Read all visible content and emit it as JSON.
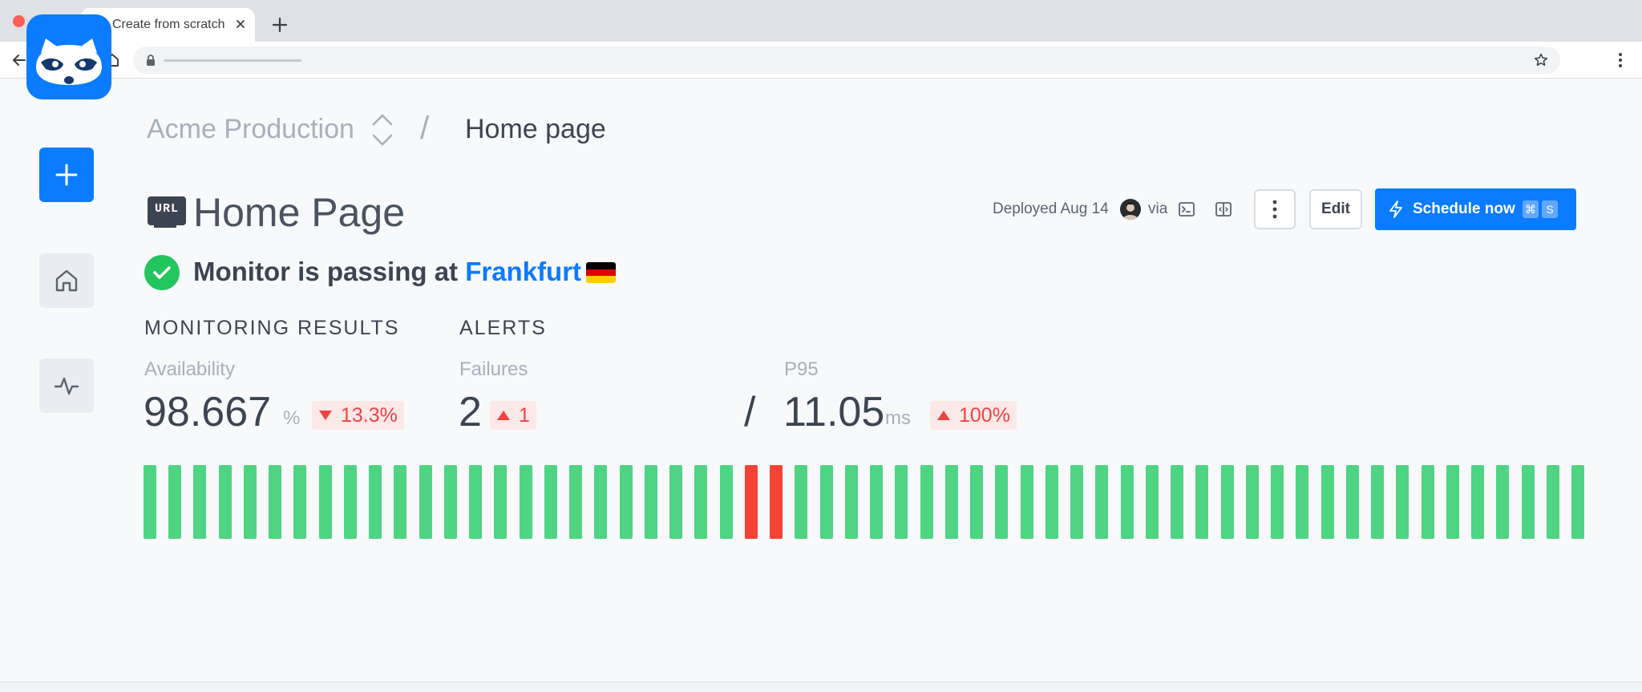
{
  "browser": {
    "tab_title": "Create from scratch",
    "colors": {
      "tabstrip": "#dee1e6",
      "toolbar": "#ffffff"
    }
  },
  "breadcrumb": {
    "project": "Acme Production",
    "separator": "/",
    "current": "Home page"
  },
  "check": {
    "type_badge": "URL",
    "title": "Home Page",
    "deployed": "Deployed Aug 14",
    "via": "via",
    "actions": {
      "edit_label": "Edit",
      "schedule_label": "Schedule now",
      "shortcut_cmd": "⌘",
      "shortcut_key": "S"
    }
  },
  "status": {
    "prefix": "Monitor is passing at ",
    "location": "Frankfurt",
    "flag_colors": [
      "#000000",
      "#dd0000",
      "#ffce00"
    ]
  },
  "monitoring": {
    "section_title": "MONITORING RESULTS",
    "availability": {
      "label": "Availability",
      "value": "98.667",
      "unit": "%",
      "delta": "13.3%",
      "direction": "down"
    }
  },
  "alerts": {
    "section_title": "ALERTS",
    "failures": {
      "label": "Failures",
      "value": "2",
      "delta": "1",
      "direction": "up"
    },
    "separator": "/",
    "p95": {
      "label": "P95",
      "value": "11.05",
      "unit": "ms",
      "delta": "100%",
      "direction": "up"
    }
  },
  "results_timeline": {
    "statuses": [
      "pass",
      "pass",
      "pass",
      "pass",
      "pass",
      "pass",
      "pass",
      "pass",
      "pass",
      "pass",
      "pass",
      "pass",
      "pass",
      "pass",
      "pass",
      "pass",
      "pass",
      "pass",
      "pass",
      "pass",
      "pass",
      "pass",
      "pass",
      "pass",
      "fail",
      "fail",
      "pass",
      "pass",
      "pass",
      "pass",
      "pass",
      "pass",
      "pass",
      "pass",
      "pass",
      "pass",
      "pass",
      "pass",
      "pass",
      "pass",
      "pass",
      "pass",
      "pass",
      "pass",
      "pass",
      "pass",
      "pass",
      "pass",
      "pass",
      "pass",
      "pass",
      "pass",
      "pass",
      "pass",
      "pass",
      "pass",
      "pass",
      "pass"
    ],
    "colors": {
      "pass": "#4ed483",
      "fail": "#f44336"
    }
  },
  "colors": {
    "accent": "#0b7bff",
    "success": "#22c55e",
    "danger": "#ef4444"
  }
}
